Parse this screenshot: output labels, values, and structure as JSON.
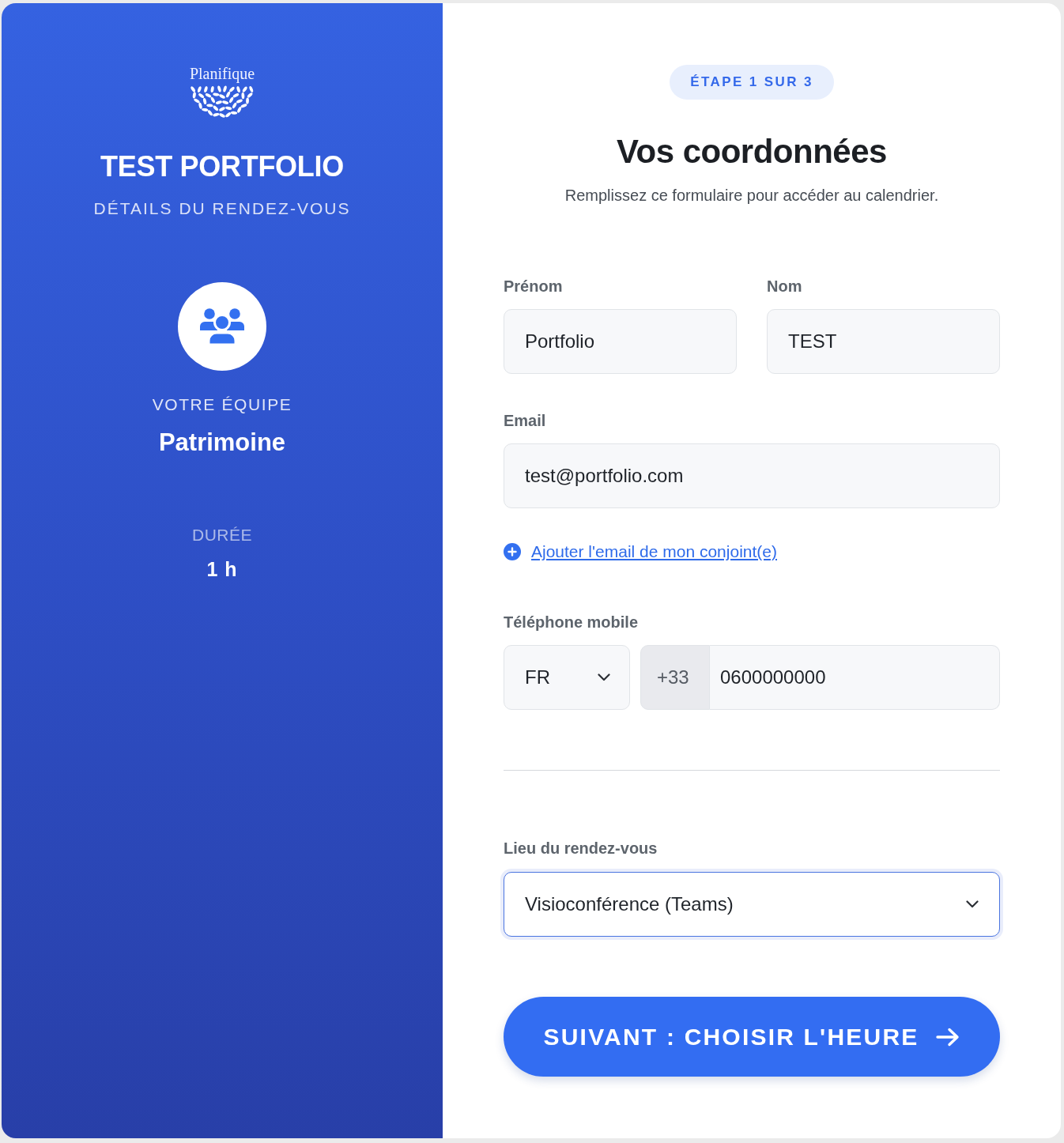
{
  "sidebar": {
    "logo": "Planifique",
    "title": "TEST PORTFOLIO",
    "subtitle": "DÉTAILS DU RENDEZ-VOUS",
    "team": {
      "label": "VOTRE ÉQUIPE",
      "name": "Patrimoine"
    },
    "duration": {
      "label": "DURÉE",
      "value": "1 h"
    }
  },
  "form": {
    "step": "ÉTAPE 1 SUR 3",
    "title": "Vos coordonnées",
    "subtitle": "Remplissez ce formulaire pour accéder au calendrier.",
    "name_fields": [
      {
        "label": "Prénom",
        "value": "Portfolio"
      },
      {
        "label": "Nom",
        "value": "TEST"
      }
    ],
    "email": {
      "label": "Email",
      "value": "test@portfolio.com"
    },
    "add_spouse_link": "Ajouter l'email de mon conjoint(e)",
    "phone": {
      "label": "Téléphone mobile",
      "country": "FR",
      "prefix": "+33",
      "value": "0600000000"
    },
    "location": {
      "label": "Lieu du rendez-vous",
      "value": "Visioconférence (Teams)",
      "focused": true
    },
    "next_button": "SUIVANT : CHOISIR L'HEURE"
  }
}
